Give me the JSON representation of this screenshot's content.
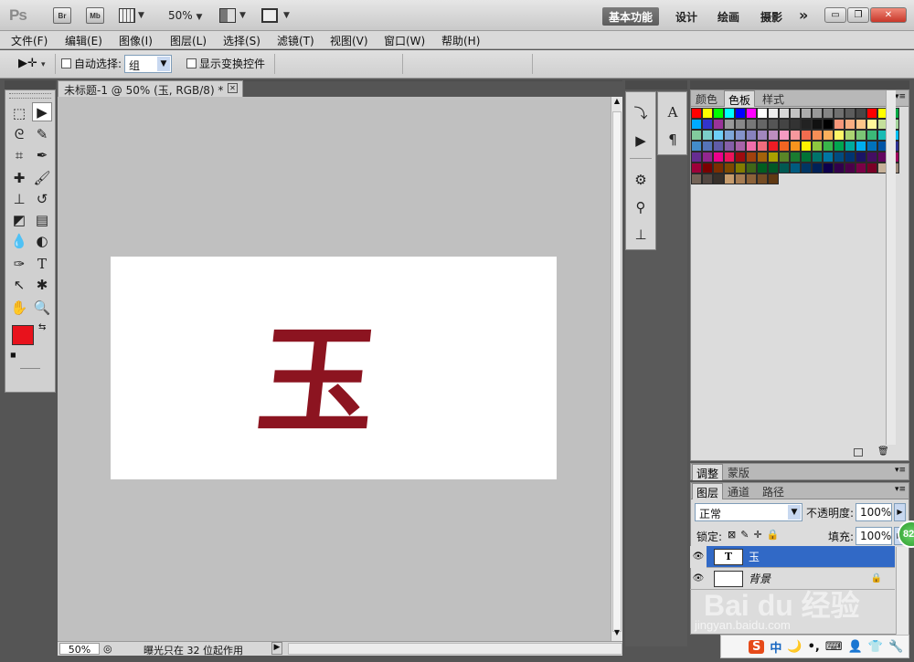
{
  "app": {
    "logo": "Ps",
    "bridge_label": "Br",
    "minibridge_label": "Mb",
    "zoom": "50%",
    "workspaces": [
      "基本功能",
      "设计",
      "绘画",
      "摄影"
    ],
    "more_glyph": "»"
  },
  "menu": [
    "文件(F)",
    "编辑(E)",
    "图像(I)",
    "图层(L)",
    "选择(S)",
    "滤镜(T)",
    "视图(V)",
    "窗口(W)",
    "帮助(H)"
  ],
  "options": {
    "auto_select_label": "自动选择:",
    "auto_select_value": "组",
    "show_transform_label": "显示变换控件"
  },
  "document": {
    "tab_title": "未标题-1 @ 50% (玉, RGB/8) *",
    "text_content": "玉",
    "text_color": "#8c1420",
    "status_zoom": "50%",
    "status_message": "曝光只在 32 位起作用"
  },
  "tools": {
    "foreground_color": "#e8121c",
    "background_color": "#5a5a5a"
  },
  "swatches_panel": {
    "tabs": [
      "颜色",
      "色板",
      "样式"
    ],
    "active_tab": "色板",
    "colors": [
      "#ff0000",
      "#ffff00",
      "#00ff00",
      "#00ffff",
      "#0000ff",
      "#ff00ff",
      "#ffffff",
      "#ebebeb",
      "#d6d6d6",
      "#c2c2c2",
      "#adadad",
      "#999999",
      "#858585",
      "#707070",
      "#5c5c5c",
      "#474747",
      "#ff0000",
      "#ffff00",
      "#00aa44",
      "#00aaff",
      "#3333cc",
      "#993399",
      "#999999",
      "#888888",
      "#777777",
      "#666666",
      "#555555",
      "#444444",
      "#333333",
      "#222222",
      "#111111",
      "#000000",
      "#f7977a",
      "#f9ad81",
      "#fdc68a",
      "#fff79a",
      "#c4df9b",
      "#a3d39c",
      "#82ca9d",
      "#7bcdc8",
      "#6ecff6",
      "#7ea7d8",
      "#8493ca",
      "#8882be",
      "#a187be",
      "#bc8dbf",
      "#f49ac2",
      "#f6989d",
      "#f26c4f",
      "#f68e56",
      "#fbaf5c",
      "#fff467",
      "#acd372",
      "#7cc576",
      "#3bb878",
      "#1abbb4",
      "#00bff3",
      "#438ccb",
      "#5574b9",
      "#605ca8",
      "#855fa8",
      "#a763a8",
      "#f06eaa",
      "#f26d7d",
      "#ed1c24",
      "#f26522",
      "#f7941d",
      "#fff200",
      "#8dc73f",
      "#39b54a",
      "#00a651",
      "#00a99d",
      "#00aeef",
      "#0072bc",
      "#0054a6",
      "#2e3192",
      "#662d91",
      "#92278f",
      "#ec008c",
      "#ed145b",
      "#9e0b0f",
      "#a0410d",
      "#a3620a",
      "#aba000",
      "#598527",
      "#1a7b30",
      "#007236",
      "#00746b",
      "#0076a3",
      "#004b80",
      "#003471",
      "#1b1464",
      "#440e62",
      "#630460",
      "#9e005d",
      "#9e0039",
      "#790000",
      "#7b2e00",
      "#7d4900",
      "#827b00",
      "#406618",
      "#005e20",
      "#005826",
      "#005952",
      "#005b7f",
      "#003663",
      "#002157",
      "#0d004c",
      "#32004b",
      "#4b0049",
      "#7b0046",
      "#7a0026",
      "#c7b299",
      "#998675",
      "#736357",
      "#534741",
      "#37302a",
      "#c69c6d",
      "#a67c52",
      "#8c6239",
      "#754c24",
      "#603913"
    ],
    "adjust_tabs": [
      "调整",
      "蒙版"
    ]
  },
  "layers_panel": {
    "tabs": [
      "图层",
      "通道",
      "路径"
    ],
    "active_tab": "图层",
    "blend_mode": "正常",
    "opacity_label": "不透明度:",
    "opacity_value": "100%",
    "lock_label": "锁定:",
    "fill_label": "填充:",
    "fill_value": "100%",
    "layers": [
      {
        "name": "玉",
        "type": "text",
        "selected": true,
        "thumb": "T"
      },
      {
        "name": "背景",
        "type": "background",
        "selected": false,
        "locked": true
      }
    ],
    "badge": "82"
  },
  "tray": [
    "S",
    "中",
    "🌙"
  ],
  "watermark": {
    "brand": "Bai du 经验",
    "url": "jingyan.baidu.com"
  }
}
